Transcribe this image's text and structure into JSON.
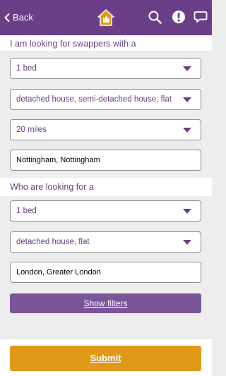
{
  "topbar": {
    "back_label": "Back",
    "icons": [
      "chevron-left-icon",
      "home-thumbs-up-logo",
      "search-icon",
      "alert-icon",
      "chat-icon"
    ],
    "colors": {
      "bar": "#6b3f87",
      "logo": "#e09a17"
    }
  },
  "have": {
    "heading": "I am looking for swappers with a",
    "bedrooms": "1 bed",
    "property_types": "detached house, semi-detached house, flat",
    "distance": "20 miles",
    "location": "Nottingham, Nottingham"
  },
  "want": {
    "heading": "Who are looking for a",
    "bedrooms": "1 bed",
    "property_types": "detached house, flat",
    "location": "London, Greater London"
  },
  "buttons": {
    "show_filters": "Show filters",
    "submit": "Submit"
  },
  "colors": {
    "accent": "#6b3f87",
    "filters_button": "#7c5498",
    "submit_button": "#e09a17"
  }
}
